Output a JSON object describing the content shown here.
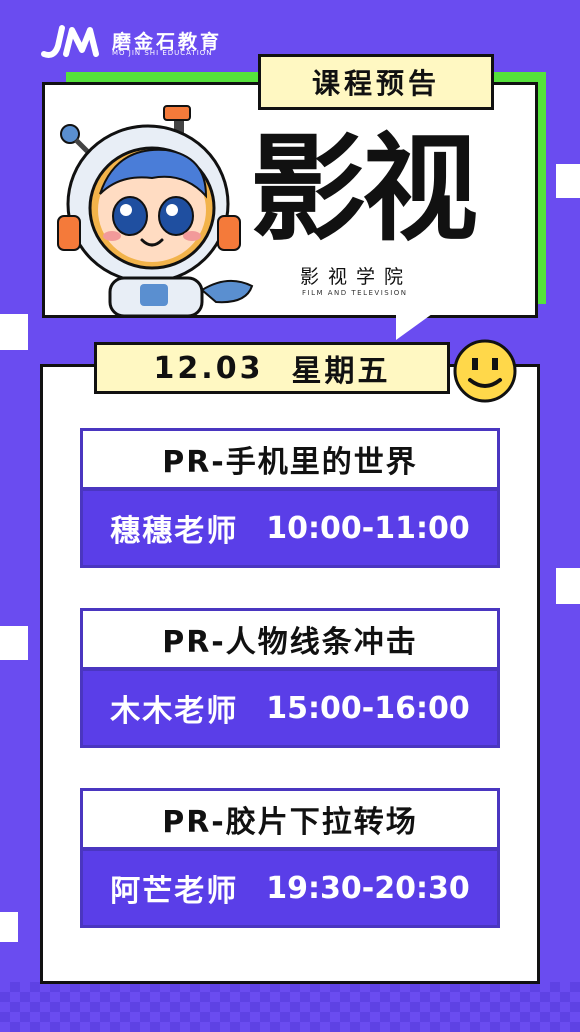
{
  "brand": {
    "name_cn": "磨金石教育",
    "name_en": "MO JIN SHI EDUCATION",
    "logo_icon": "jm-logo-icon"
  },
  "header": {
    "tag": "课程预告",
    "title": "影视",
    "subtitle_cn": "影视学院",
    "subtitle_en": "FILM AND TELEVISION"
  },
  "date": {
    "day": "12.03",
    "weekday": "星期五"
  },
  "courses": [
    {
      "title": "PR-手机里的世界",
      "teacher": "穗穗老师",
      "time": "10:00-11:00"
    },
    {
      "title": "PR-人物线条冲击",
      "teacher": "木木老师",
      "time": "15:00-16:00"
    },
    {
      "title": "PR-胶片下拉转场",
      "teacher": "阿芒老师",
      "time": "19:30-20:30"
    }
  ],
  "colors": {
    "background": "#6a4cf0",
    "accent_green": "#55e23c",
    "tag_yellow": "#fff8c2",
    "course_purple": "#5a3ee8",
    "smiley": "#ffd84a"
  }
}
